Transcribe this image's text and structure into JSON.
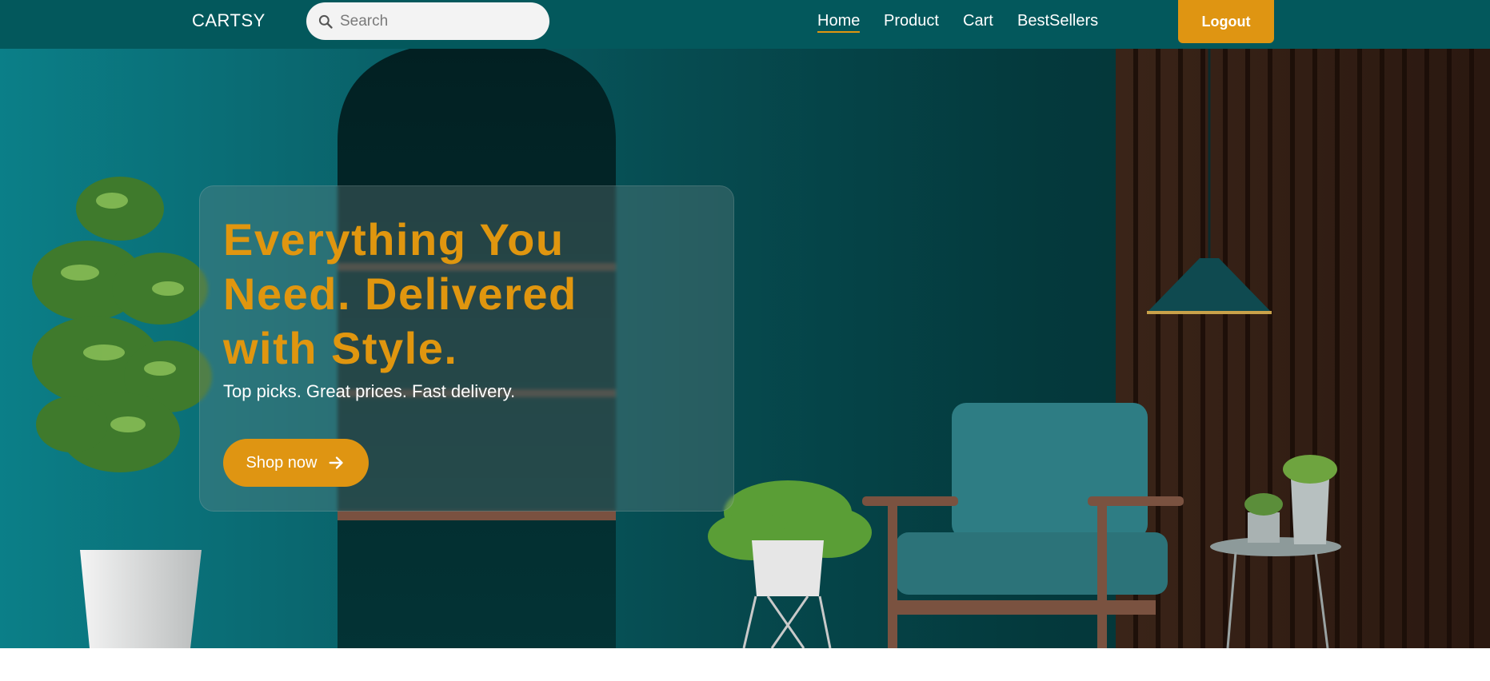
{
  "navbar": {
    "brand": "CARTSY",
    "search_placeholder": "Search",
    "links": [
      {
        "label": "Home",
        "active": true
      },
      {
        "label": "Product",
        "active": false
      },
      {
        "label": "Cart",
        "active": false
      },
      {
        "label": "BestSellers",
        "active": false
      }
    ],
    "logout_label": "Logout"
  },
  "hero": {
    "title": "Everything You Need. Delivered with Style.",
    "subtitle": "Top picks. Great prices. Fast delivery.",
    "cta_label": "Shop now",
    "cta_icon": "arrow-right-icon"
  },
  "colors": {
    "nav_bg": "#03585c",
    "accent": "#df9512",
    "hero_teal": "#0a6a72",
    "text_light": "#ffffff"
  }
}
